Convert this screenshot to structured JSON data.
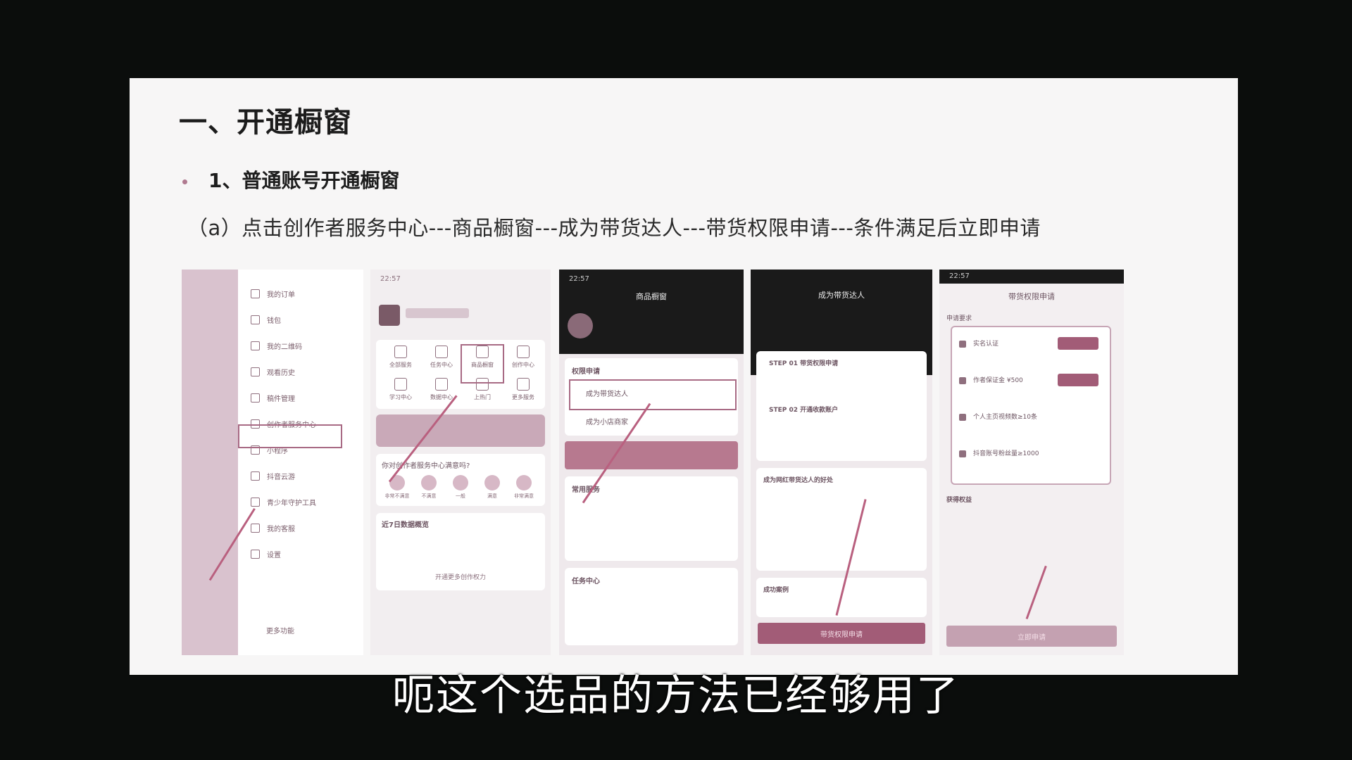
{
  "slide": {
    "title": "一、开通橱窗",
    "subtitle": "1、普通账号开通橱窗",
    "step": "（a）点击创作者服务中心---商品橱窗---成为带货达人---带货权限申请---条件满足后立即申请"
  },
  "screens": {
    "menu": {
      "items": [
        "我的订单",
        "钱包",
        "我的二维码",
        "观看历史",
        "稿件管理",
        "创作者服务中心",
        "小程序",
        "抖音云游",
        "青少年守护工具",
        "我的客服",
        "设置"
      ],
      "more": "更多功能"
    },
    "center": {
      "time": "22:57",
      "tools": [
        "全部服务",
        "任务中心",
        "商品橱窗",
        "创作中心",
        "学习中心",
        "数据中心",
        "上热门",
        "更多服务"
      ],
      "survey": "你对创作者服务中心满意吗?",
      "faces": [
        "非常不满意",
        "不满意",
        "一般",
        "满意",
        "非常满意"
      ],
      "data_title": "近7日数据概览",
      "open_more": "开通更多创作权力"
    },
    "showcase": {
      "time": "22:57",
      "title": "商品橱窗",
      "section": "权限申请",
      "item1": "成为带货达人",
      "item2": "成为小店商家",
      "services": "常用服务",
      "task": "任务中心"
    },
    "become": {
      "title": "成为带货达人",
      "step1": "STEP 01 带货权限申请",
      "step2": "STEP 02 开通收款账户",
      "why": "成为网红带货达人的好处",
      "case": "成功案例",
      "button": "带货权限申请"
    },
    "apply": {
      "time": "22:57",
      "title": "带货权限申请",
      "req": "申请要求",
      "conds": [
        "实名认证",
        "作者保证金 ¥500",
        "个人主页视频数≥10条",
        "抖音账号粉丝量≥1000"
      ],
      "rights": "获得权益",
      "button": "立即申请"
    }
  },
  "caption": "呃这个选品的方法已经够用了"
}
